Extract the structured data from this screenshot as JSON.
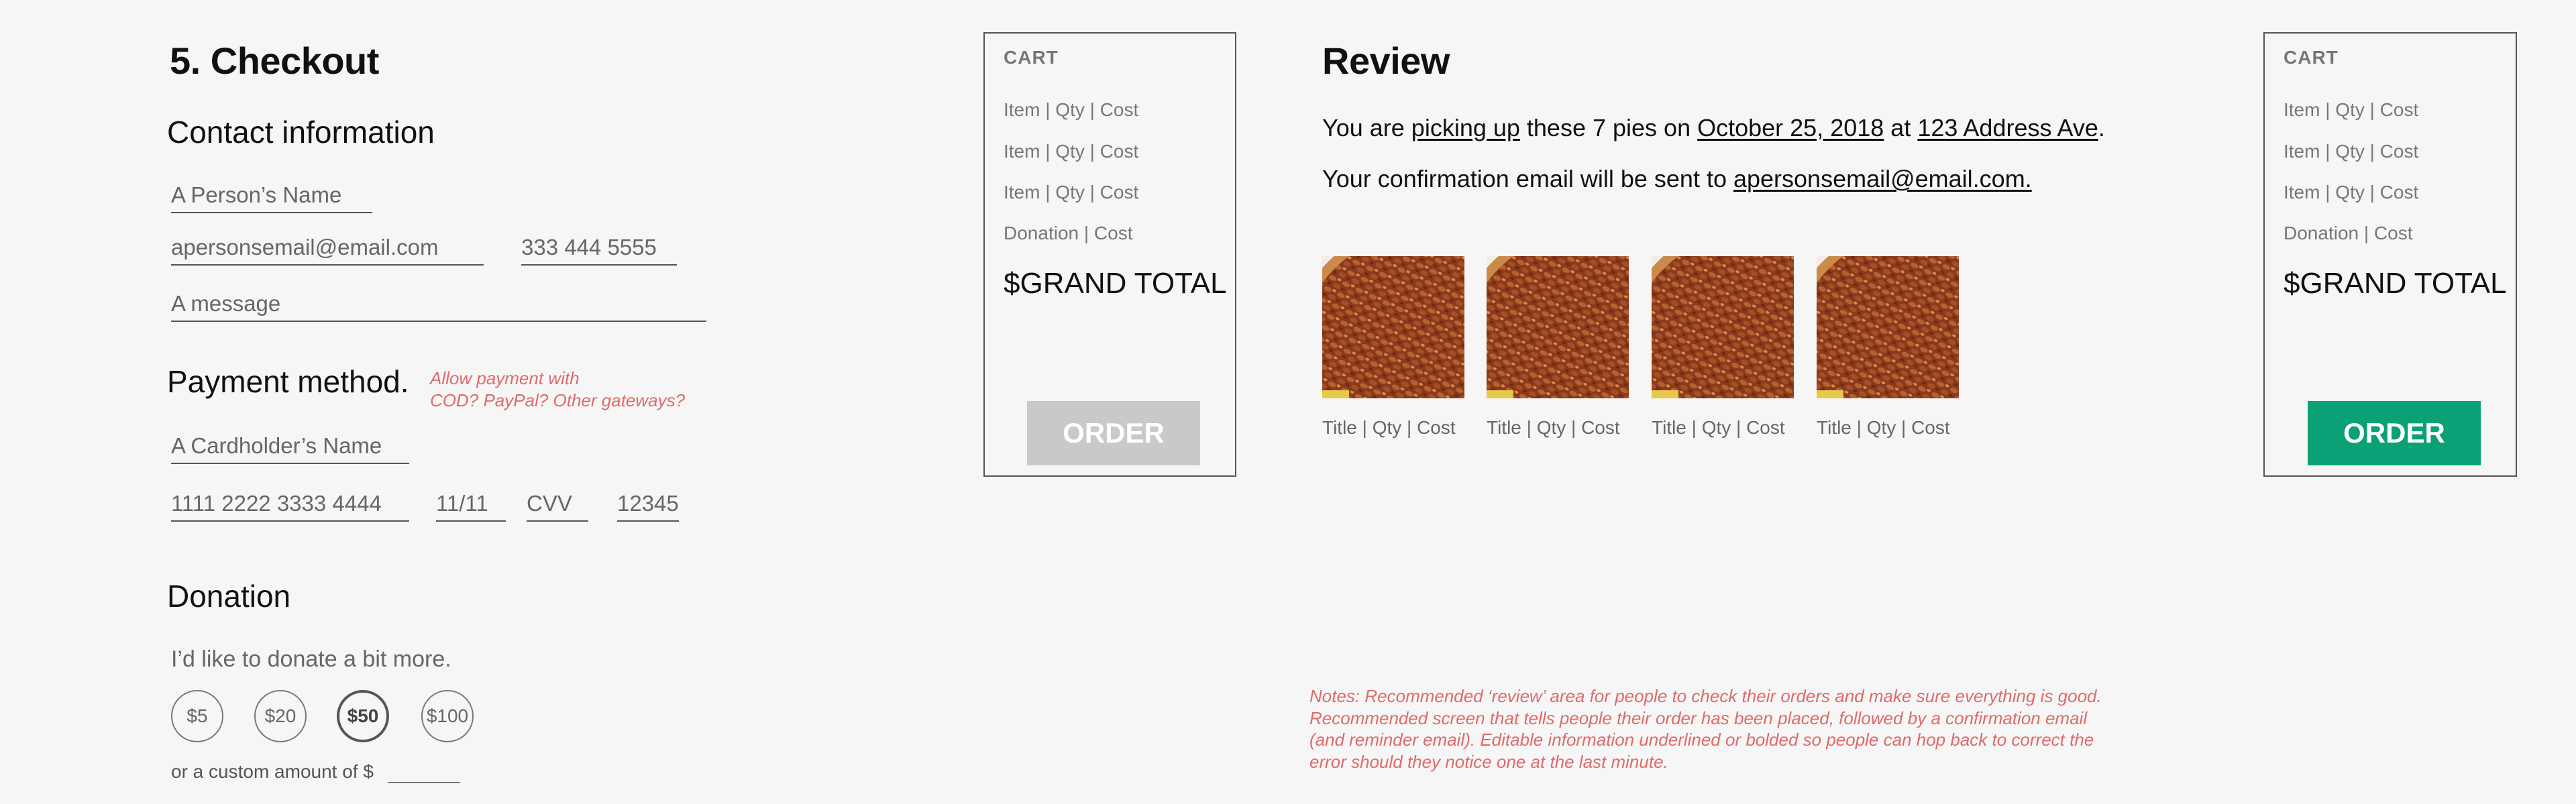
{
  "checkout": {
    "title": "5. Checkout",
    "contact_heading": "Contact information",
    "name_value": "A Person’s Name",
    "email_value": "apersonsemail@email.com",
    "phone_value": "333 444 5555",
    "message_value": "A message",
    "payment_heading": "Payment method.",
    "payment_note_line1": "Allow payment with",
    "payment_note_line2": "COD? PayPal? Other gateways?",
    "cardholder_value": "A Cardholder’s Name",
    "card_number_value": "1111 2222 3333 4444",
    "expiry_value": "11/11",
    "cvv_value": "CVV",
    "zip_value": "12345",
    "donation_heading": "Donation",
    "donation_text": "I’d like to donate a bit more.",
    "donation_options": [
      "$5",
      "$20",
      "$50",
      "$100"
    ],
    "donation_selected": "$50",
    "custom_amount_label": "or a custom amount of $"
  },
  "cart_left": {
    "title": "CART",
    "lines": [
      "Item | Qty | Cost",
      "Item | Qty | Cost",
      "Item | Qty | Cost",
      "Donation | Cost"
    ],
    "grand_total": "$GRAND TOTAL",
    "order_label": "ORDER",
    "order_state": "disabled",
    "order_color": "#c9c9c9"
  },
  "review": {
    "title": "Review",
    "line1_a": "You are ",
    "line1_method": "picking up",
    "line1_b": " these 7 pies on ",
    "line1_date": "October 25, 2018",
    "line1_c": " at ",
    "line1_address": "123 Address Ave",
    "line1_d": ".",
    "line2_a": "Your confirmation email will be sent to ",
    "line2_email": "apersonsemail@email.com.",
    "products": [
      {
        "caption": "Title | Qty | Cost"
      },
      {
        "caption": "Title | Qty | Cost"
      },
      {
        "caption": "Title | Qty | Cost"
      },
      {
        "caption": "Title | Qty | Cost"
      }
    ],
    "notes": [
      "Notes: Recommended ‘review’ area for people to check their orders and make sure everything is good.",
      "Recommended screen that tells people their order has been placed, followed by a confirmation email",
      "(and reminder email). Editable information underlined or bolded so people can hop back to correct the",
      "error should they notice one at the last minute."
    ]
  },
  "cart_right": {
    "title": "CART",
    "lines": [
      "Item | Qty | Cost",
      "Item | Qty | Cost",
      "Item | Qty | Cost",
      "Donation | Cost"
    ],
    "grand_total": "$GRAND TOTAL",
    "order_label": "ORDER",
    "order_state": "enabled",
    "order_color": "#0aa176"
  },
  "colors": {
    "accent_green": "#0aa176",
    "note_red": "#e06a6a",
    "disabled_gray": "#c9c9c9"
  }
}
